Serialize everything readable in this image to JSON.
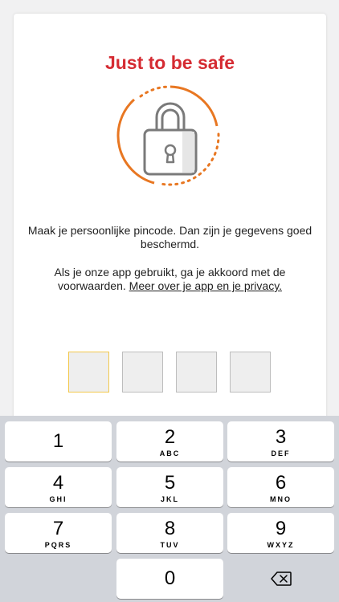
{
  "header": {
    "title": "Just to be safe",
    "title_color": "#d52b32"
  },
  "illustration": {
    "icon": "lock-icon",
    "ring_color": "#e87722"
  },
  "message": {
    "line1": "Maak je persoonlijke pincode. Dan zijn je gegevens goed beschermd.",
    "line2_prefix": "Als je onze app gebruikt, ga je akkoord met de voorwaarden. ",
    "privacy_link": "Meer over je app en je privacy."
  },
  "pin": {
    "length": 4,
    "active_index": 0
  },
  "keypad": {
    "keys": [
      {
        "digit": "1",
        "letters": ""
      },
      {
        "digit": "2",
        "letters": "ABC"
      },
      {
        "digit": "3",
        "letters": "DEF"
      },
      {
        "digit": "4",
        "letters": "GHI"
      },
      {
        "digit": "5",
        "letters": "JKL"
      },
      {
        "digit": "6",
        "letters": "MNO"
      },
      {
        "digit": "7",
        "letters": "PQRS"
      },
      {
        "digit": "8",
        "letters": "TUV"
      },
      {
        "digit": "9",
        "letters": "WXYZ"
      },
      {
        "digit": "0",
        "letters": ""
      }
    ],
    "delete_icon": "backspace-icon"
  }
}
